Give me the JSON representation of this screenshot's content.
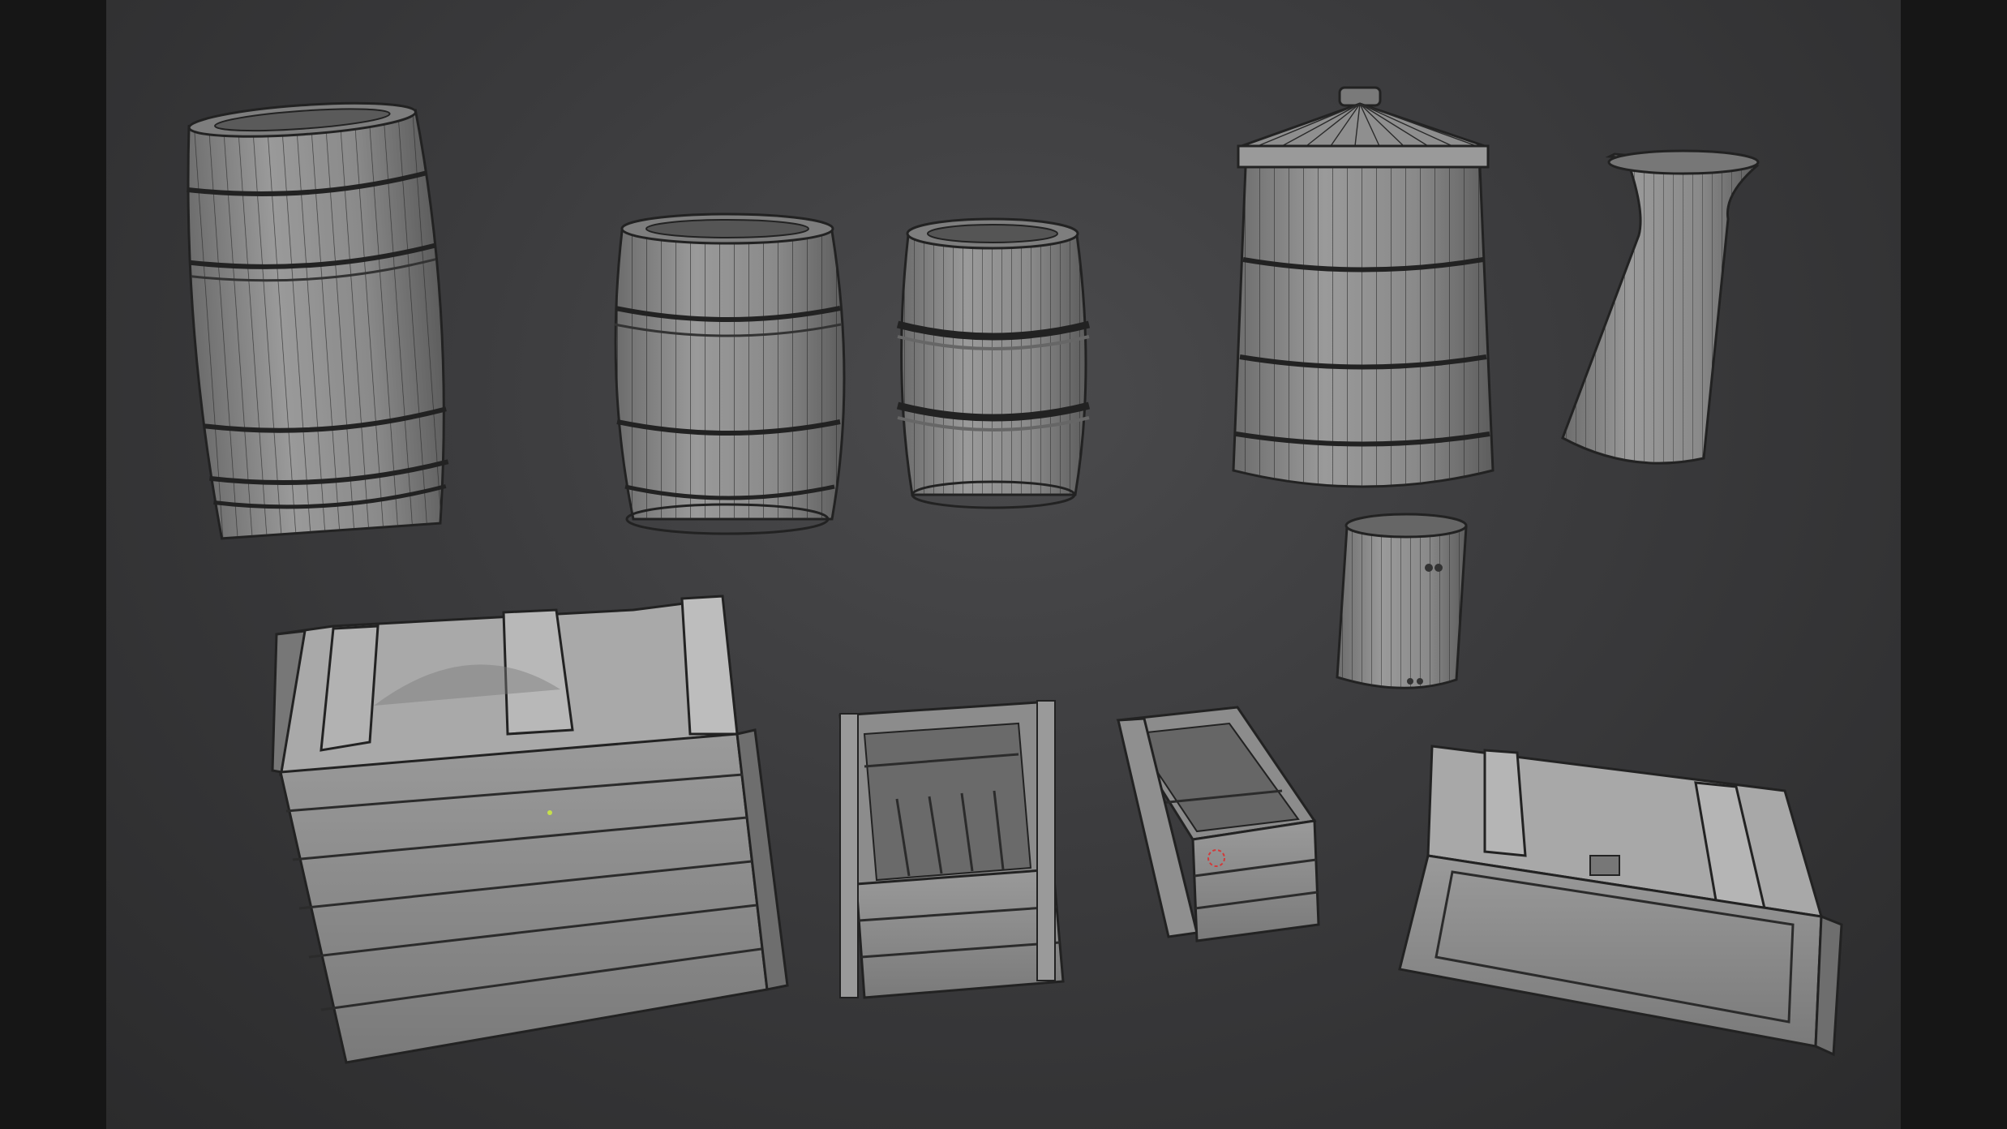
{
  "viewport": {
    "background_color": "#3e3e40",
    "mesh_fill": "#8a8a8a",
    "mesh_wire": "#1e1e1e",
    "origin_color": "#c6e04a",
    "cursor_color": "#d23a3a"
  },
  "objects": [
    {
      "name": "barrel-large-tilted",
      "kind": "barrel"
    },
    {
      "name": "barrel-medium",
      "kind": "barrel"
    },
    {
      "name": "barrel-small-hooped",
      "kind": "barrel"
    },
    {
      "name": "lidded-tank",
      "kind": "bin"
    },
    {
      "name": "tall-pitcher",
      "kind": "pitcher"
    },
    {
      "name": "small-bucket",
      "kind": "bucket"
    },
    {
      "name": "large-crate-closed",
      "kind": "crate"
    },
    {
      "name": "open-crate",
      "kind": "crate"
    },
    {
      "name": "small-open-crate",
      "kind": "crate"
    },
    {
      "name": "long-chest-with-latch",
      "kind": "crate"
    }
  ]
}
